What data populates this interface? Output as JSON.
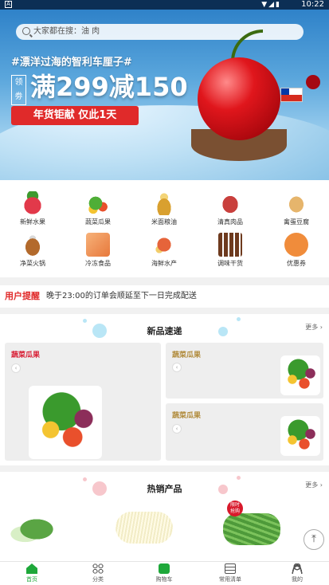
{
  "status_bar": {
    "time": "10:22",
    "left_icon": "A"
  },
  "search": {
    "placeholder": "大家都在搜：油 肉"
  },
  "banner": {
    "hashtag": "#漂洋过海的智利车厘子#",
    "coupon_tag": "领劵",
    "headline": "满299减150",
    "cta": "年货钜献 仅此1天"
  },
  "categories": [
    {
      "label": "新鲜水果",
      "icon": "strawberry-icon",
      "color": "#e2394a"
    },
    {
      "label": "蔬菜瓜果",
      "icon": "vegetables-icon",
      "color": "#4fae37"
    },
    {
      "label": "米面粮油",
      "icon": "grain-oil-icon",
      "color": "#d9a02f"
    },
    {
      "label": "清真肉品",
      "icon": "meat-icon",
      "color": "#c9403d"
    },
    {
      "label": "禽蛋豆腐",
      "icon": "egg-icon",
      "color": "#e6b56c"
    },
    {
      "label": "净菜火锅",
      "icon": "hotpot-icon",
      "color": "#b36a2c"
    },
    {
      "label": "冷冻食品",
      "icon": "frozen-food-icon",
      "color": "#e7783b"
    },
    {
      "label": "海鲜水产",
      "icon": "seafood-icon",
      "color": "#e6643a"
    },
    {
      "label": "调味干货",
      "icon": "seasoning-icon",
      "color": "#6e3a1e"
    },
    {
      "label": "优惠券",
      "icon": "coupon-icon",
      "color": "#f08c3b"
    }
  ],
  "notice": {
    "tag": "用户提醒",
    "text": "晚于23:00的订单会顺延至下一日完成配送"
  },
  "new_products": {
    "title": "新品速递",
    "more": "更多",
    "cards": [
      {
        "label": "蔬菜瓜果",
        "label_color": "#d81b32"
      },
      {
        "label": "蔬菜瓜果",
        "label_color": "#b08a3a"
      },
      {
        "label": "蔬菜瓜果",
        "label_color": "#b08a3a"
      }
    ]
  },
  "hot_products": {
    "title": "热销产品",
    "more": "更多",
    "badge": "限时\n抢购",
    "items": [
      "vegetable-greens-icon",
      "bean-sprouts-icon",
      "green-beans-icon"
    ]
  },
  "tabbar": [
    {
      "label": "首页",
      "icon": "home-icon",
      "active": true
    },
    {
      "label": "分类",
      "icon": "grid-icon",
      "active": false
    },
    {
      "label": "购物车",
      "icon": "cart-icon",
      "active": false
    },
    {
      "label": "常用清单",
      "icon": "list-icon",
      "active": false
    },
    {
      "label": "我的",
      "icon": "user-icon",
      "active": false
    }
  ]
}
